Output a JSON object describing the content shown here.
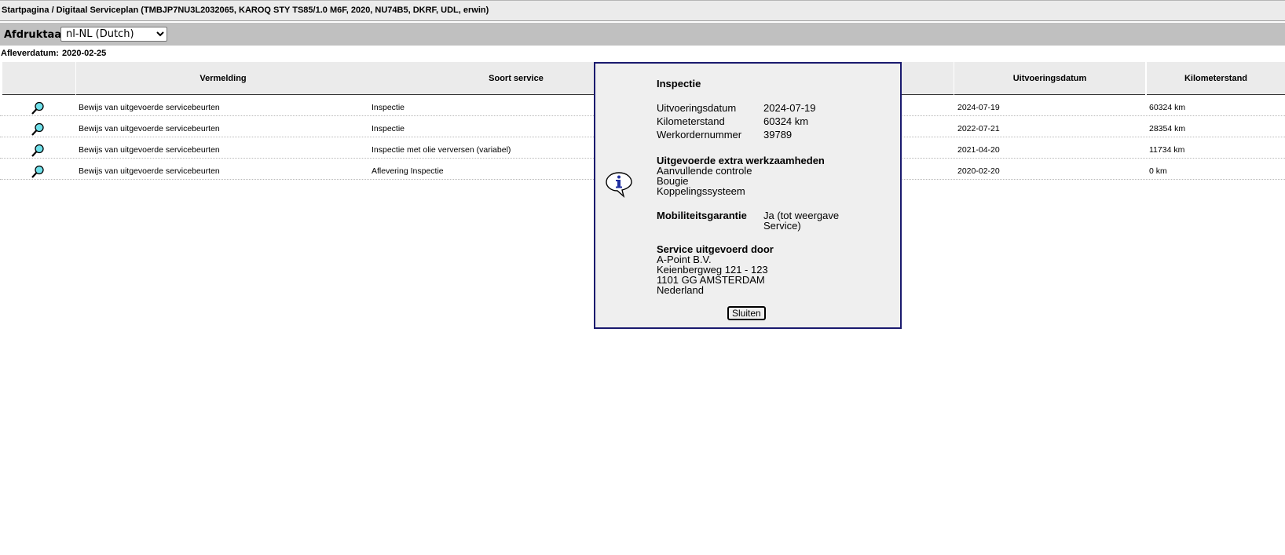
{
  "breadcrumb": "Startpagina / Digitaal Serviceplan (TMBJP7NU3L2032065, KAROQ STY TS85/1.0 M6F, 2020, NU74B5, DKRF, UDL, erwin)",
  "language": {
    "label": "Afdruktaal:",
    "selected": "nl-NL (Dutch)"
  },
  "delivery": {
    "label": "Afleverdatum:",
    "value": "2020-02-25"
  },
  "table": {
    "headers": {
      "vermelding": "Vermelding",
      "soort": "Soort service",
      "datum": "Uitvoeringsdatum",
      "km": "Kilometerstand"
    },
    "rows": [
      {
        "vermelding": "Bewijs van uitgevoerde servicebeurten",
        "soort": "Inspectie",
        "datum": "2024-07-19",
        "km": "60324 km"
      },
      {
        "vermelding": "Bewijs van uitgevoerde servicebeurten",
        "soort": "Inspectie",
        "datum": "2022-07-21",
        "km": "28354 km"
      },
      {
        "vermelding": "Bewijs van uitgevoerde servicebeurten",
        "soort": "Inspectie met olie verversen (variabel)",
        "datum": "2021-04-20",
        "km": "11734 km"
      },
      {
        "vermelding": "Bewijs van uitgevoerde servicebeurten",
        "soort": "Aflevering Inspectie",
        "datum": "2020-02-20",
        "km": "0 km"
      }
    ]
  },
  "popup": {
    "title": "Inspectie",
    "fields": [
      {
        "label": "Uitvoeringsdatum",
        "value": "2024-07-19"
      },
      {
        "label": "Kilometerstand",
        "value": "60324 km"
      },
      {
        "label": "Werkordernummer",
        "value": "39789"
      }
    ],
    "extra_heading": "Uitgevoerde extra werkzaamheden",
    "extra_items": [
      "Aanvullende controle",
      "Bougie",
      "Koppelingssysteem"
    ],
    "mobility_label": "Mobiliteitsgarantie",
    "mobility_value": "Ja (tot weergave Service)",
    "service_heading": "Service uitgevoerd door",
    "service_lines": [
      "A-Point B.V.",
      "Keienbergweg 121 - 123",
      "1101 GG AMSTERDAM",
      "Nederland"
    ],
    "close_label": "Sluiten"
  },
  "icons": {
    "row_action": "magnifier-icon",
    "popup": "info-icon"
  },
  "colors": {
    "header_bg": "#ebebeb",
    "lang_bar_bg": "#c0c0c0",
    "popup_border": "#1a1a6e",
    "popup_bg": "#efefef"
  }
}
